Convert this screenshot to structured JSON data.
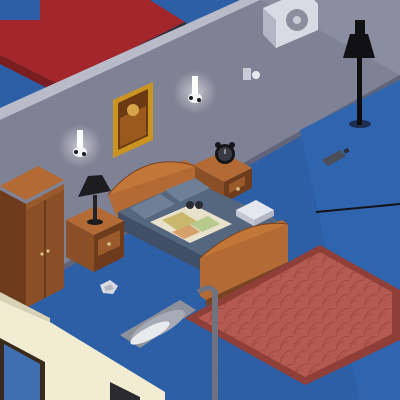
{
  "scene": {
    "kind": "isometric-bedroom",
    "palette": {
      "carpet": "#2d5fa6",
      "carpet_dark": "#244f8d",
      "wall": "#7f8194",
      "wall_light": "#9b9daf",
      "wall_top": "#b9bbc9",
      "wood": "#8a4f27",
      "wood_dark": "#5e3418",
      "blanket": "#55677f",
      "rug": "#b55a50",
      "rug_border": "#8f3e38",
      "red_floor": "#a3262b",
      "ext_wall": "#f1ecd2"
    },
    "objects": [
      {
        "id": "bed",
        "icon": "bed-icon"
      },
      {
        "id": "map-on-bed",
        "icon": "map-icon"
      },
      {
        "id": "binoculars",
        "icon": "binoculars-icon"
      },
      {
        "id": "pillows",
        "icon": "pillow-icon"
      },
      {
        "id": "folded-towel",
        "icon": "towel-icon"
      },
      {
        "id": "nightstand-left",
        "icon": "nightstand-icon"
      },
      {
        "id": "nightstand-right",
        "icon": "nightstand-icon"
      },
      {
        "id": "table-lamp",
        "icon": "lamp-icon"
      },
      {
        "id": "alarm-clock",
        "icon": "alarm-clock-icon"
      },
      {
        "id": "wardrobe",
        "icon": "wardrobe-icon"
      },
      {
        "id": "painting",
        "icon": "painting-icon"
      },
      {
        "id": "wall-sconce-left",
        "icon": "sconce-icon"
      },
      {
        "id": "wall-sconce-right",
        "icon": "sconce-icon"
      },
      {
        "id": "light-switch",
        "icon": "switch-icon"
      },
      {
        "id": "air-conditioner",
        "icon": "ac-unit-icon"
      },
      {
        "id": "floor-lamp",
        "icon": "floor-lamp-icon"
      },
      {
        "id": "bottle-on-floor",
        "icon": "bottle-icon"
      },
      {
        "id": "crumpled-paper",
        "icon": "paper-icon"
      },
      {
        "id": "rug",
        "icon": "rug-icon"
      },
      {
        "id": "street-lamp",
        "icon": "street-lamp-icon"
      },
      {
        "id": "pole-on-floor",
        "icon": "pole-icon"
      }
    ]
  }
}
